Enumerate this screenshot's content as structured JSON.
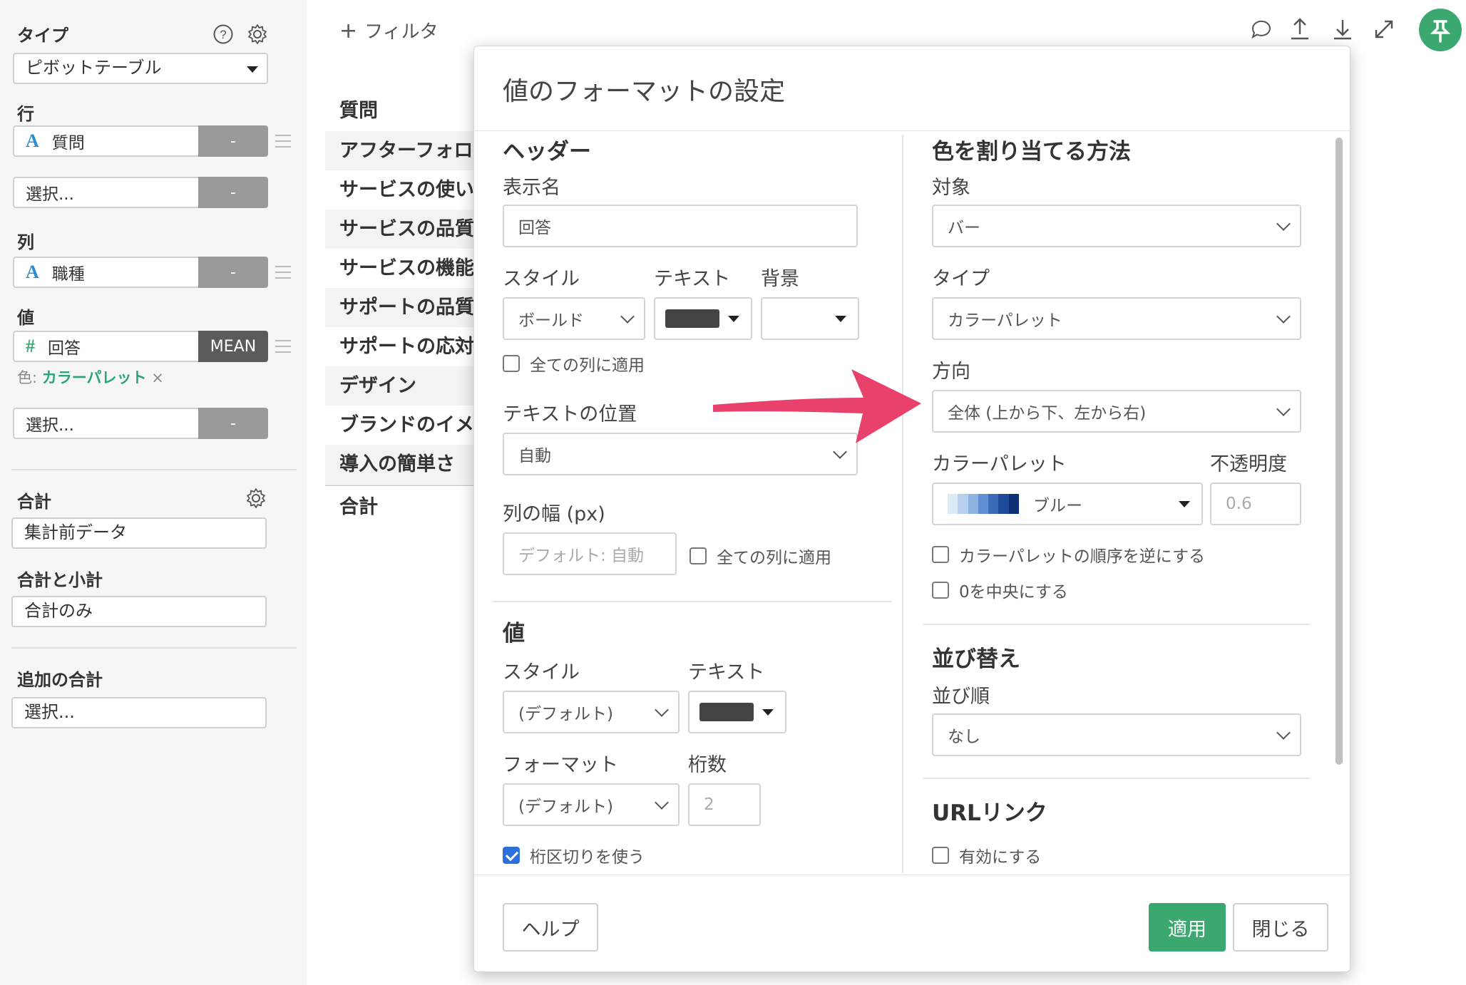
{
  "sidebar": {
    "type_label": "タイプ",
    "type_value": "ピボットテーブル",
    "row_label": "行",
    "row_field": {
      "type": "A",
      "name": "質問",
      "agg": "-"
    },
    "row_select": {
      "name": "選択...",
      "agg": "-"
    },
    "col_label": "列",
    "col_field": {
      "type": "A",
      "name": "職種",
      "agg": "-"
    },
    "val_label": "値",
    "val_field": {
      "type": "#",
      "name": "回答",
      "agg": "MEAN"
    },
    "color_prefix": "色:",
    "color_value": "カラーパレット",
    "color_remove": "×",
    "val_select": {
      "name": "選択...",
      "agg": "-"
    },
    "total_label": "合計",
    "total_value": "集計前データ",
    "subtotal_label": "合計と小計",
    "subtotal_value": "合計のみ",
    "extra_total_label": "追加の合計",
    "extra_total_value": "選択..."
  },
  "main": {
    "filter_plus": "+",
    "filter_label": "フィルタ",
    "table_header": "質問",
    "rows": [
      "アフターフォロー",
      "サービスの使いやすさ",
      "サービスの品質",
      "サービスの機能",
      "サポートの品質",
      "サポートの応対",
      "デザイン",
      "ブランドのイメージ",
      "導入の簡単さ"
    ],
    "total_row": "合計"
  },
  "modal": {
    "title": "値のフォーマットの設定",
    "header": {
      "section": "ヘッダー",
      "display_name_label": "表示名",
      "display_name_value": "回答",
      "style_label": "スタイル",
      "text_label": "テキスト",
      "bg_label": "背景",
      "style_value": "ボールド",
      "apply_all": "全ての列に適用",
      "text_pos_label": "テキストの位置",
      "text_pos_value": "自動",
      "col_width_label": "列の幅 (px)",
      "col_width_placeholder": "デフォルト: 自動",
      "col_width_apply_all": "全ての列に適用"
    },
    "value": {
      "section": "値",
      "style_label": "スタイル",
      "text_label": "テキスト",
      "style_value": "(デフォルト)",
      "format_label": "フォーマット",
      "digits_label": "桁数",
      "format_value": "(デフォルト)",
      "digits_placeholder": "2",
      "thousands_sep": "桁区切りを使う"
    },
    "color": {
      "section": "色を割り当てる方法",
      "target_label": "対象",
      "target_value": "バー",
      "type_label": "タイプ",
      "type_value": "カラーパレット",
      "direction_label": "方向",
      "direction_value": "全体 (上から下、左から右)",
      "palette_label": "カラーパレット",
      "opacity_label": "不透明度",
      "palette_value": "ブルー",
      "opacity_placeholder": "0.6",
      "reverse": "カラーパレットの順序を逆にする",
      "center_zero": "0を中央にする"
    },
    "sort": {
      "section": "並び替え",
      "order_label": "並び順",
      "order_value": "なし"
    },
    "url": {
      "section": "URLリンク",
      "enable": "有効にする"
    },
    "buttons": {
      "help": "ヘルプ",
      "apply": "適用",
      "close": "閉じる"
    }
  },
  "colors": {
    "accent_green": "#3aa86f",
    "checkbox_blue": "#2f6fdc",
    "arrow_pink": "#e8416c",
    "palette": [
      "#dce9f7",
      "#b7d0ee",
      "#8db3e2",
      "#5f8fd2",
      "#3a6bb9",
      "#1f4a98",
      "#0d2f73"
    ]
  }
}
